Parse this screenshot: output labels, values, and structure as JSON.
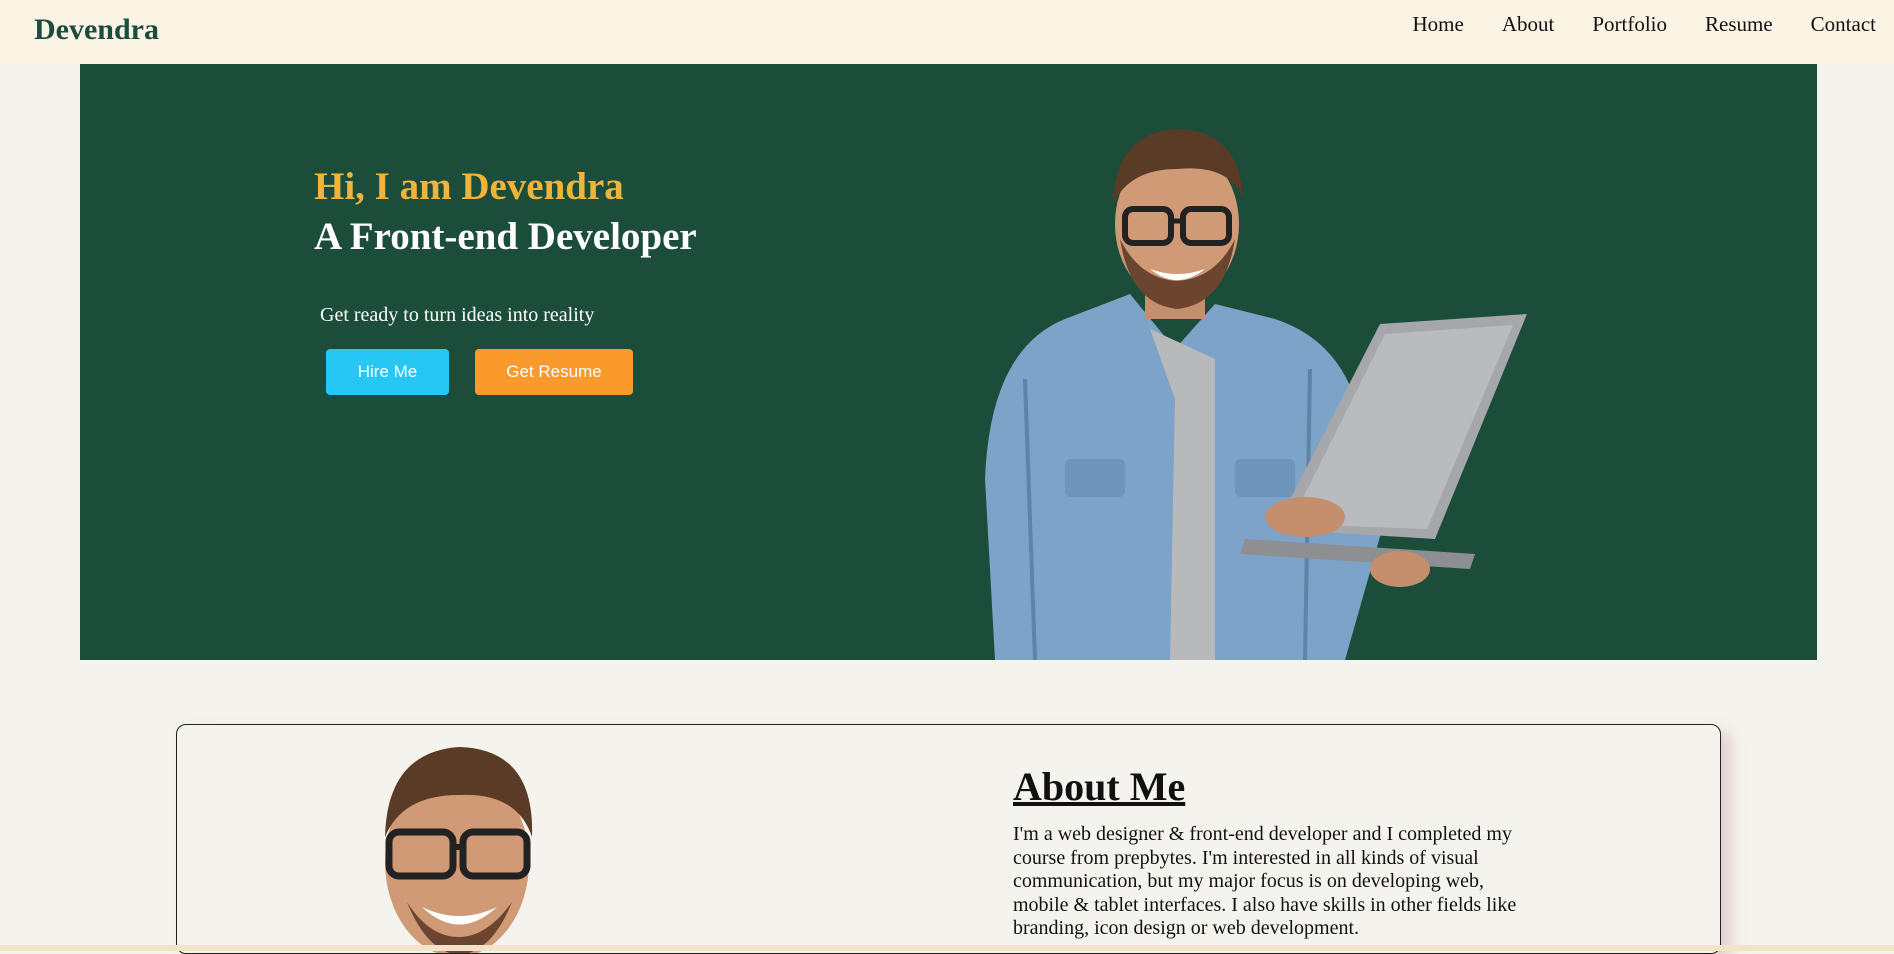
{
  "header": {
    "brand": "Devendra",
    "nav": [
      "Home",
      "About",
      "Portfolio",
      "Resume",
      "Contact"
    ]
  },
  "hero": {
    "greeting": "Hi, I am Devendra",
    "role": "A Front-end Developer",
    "tagline": "Get ready to turn ideas into reality",
    "buttons": {
      "hire": "Hire Me",
      "resume": "Get Resume"
    }
  },
  "about": {
    "title": "About Me",
    "text": "I'm a web designer & front-end developer and I completed my course from prepbytes. I'm interested in all kinds of visual communication, but my major focus is on developing web, mobile & tablet interfaces. I also have skills in other fields like branding, icon design or web development."
  },
  "colors": {
    "nav_bg": "#fbf3e4",
    "hero_bg": "#1b4d3a",
    "accent_yellow": "#f0b43a",
    "hire_button": "#27c7f5",
    "resume_button": "#fb9a2c",
    "brand": "#1b4d3e"
  }
}
